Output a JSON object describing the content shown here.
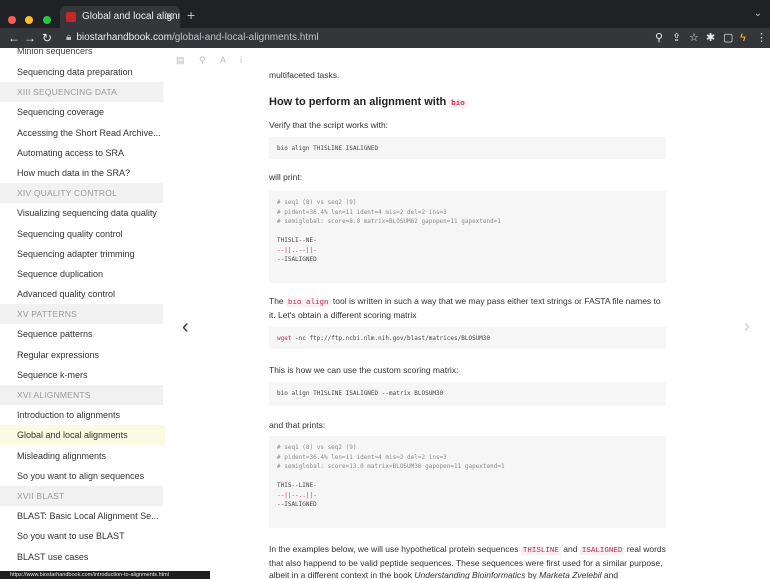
{
  "browser": {
    "tab_title": "Global and local alignments | T",
    "url_host": "biostarhandbook.com",
    "url_path": "/global-and-local-alignments.html",
    "status_url": "https://www.biostarhandbook.com/introduction-to-alignments.html",
    "colors": {
      "close": "#ff5f57",
      "minimize": "#febc2e",
      "maximize": "#28c840"
    }
  },
  "sidebar": {
    "items": [
      {
        "type": "item",
        "label": "Minion sequencers"
      },
      {
        "type": "item",
        "label": "Sequencing data preparation"
      },
      {
        "type": "header",
        "label": "XIII SEQUENCING DATA"
      },
      {
        "type": "item",
        "label": "Sequencing coverage"
      },
      {
        "type": "item",
        "label": "Accessing the Short Read Archive..."
      },
      {
        "type": "item",
        "label": "Automating access to SRA"
      },
      {
        "type": "item",
        "label": "How much data in the SRA?"
      },
      {
        "type": "header",
        "label": "XIV QUALITY CONTROL"
      },
      {
        "type": "item",
        "label": "Visualizing sequencing data quality"
      },
      {
        "type": "item",
        "label": "Sequencing quality control"
      },
      {
        "type": "item",
        "label": "Sequencing adapter trimming"
      },
      {
        "type": "item",
        "label": "Sequence duplication"
      },
      {
        "type": "item",
        "label": "Advanced quality control"
      },
      {
        "type": "header",
        "label": "XV PATTERNS"
      },
      {
        "type": "item",
        "label": "Sequence patterns"
      },
      {
        "type": "item",
        "label": "Regular expressions"
      },
      {
        "type": "item",
        "label": "Sequence k-mers"
      },
      {
        "type": "header",
        "label": "XVI ALIGNMENTS"
      },
      {
        "type": "item",
        "label": "Introduction to alignments"
      },
      {
        "type": "item",
        "label": "Global and local alignments",
        "active": true
      },
      {
        "type": "item",
        "label": "Misleading alignments"
      },
      {
        "type": "item",
        "label": "So you want to align sequences"
      },
      {
        "type": "header",
        "label": "XVII BLAST"
      },
      {
        "type": "item",
        "label": "BLAST: Basic Local Alignment Se..."
      },
      {
        "type": "item",
        "label": "So you want to use BLAST"
      },
      {
        "type": "item",
        "label": "BLAST use cases"
      }
    ]
  },
  "content": {
    "intro_tail": "multifaceted tasks.",
    "heading_text": "How to perform an alignment with",
    "heading_code": "bio",
    "verify_text": "Verify that the script works with:",
    "cmd1": "bio align THISLINE ISALIGNED",
    "will_print": "will print:",
    "output1": [
      "# seq1 (8) vs seq2 (9)",
      "# pident=36.4% len=11 ident=4 mis=2 del=2 ins=3",
      "# semiglobal: score=8.0 matrix=BLOSUM62 gapopen=11 gapextend=1",
      "",
      "THISLI--NE-",
      "--||..--||-",
      "--ISALIGNED"
    ],
    "para1_a": "The",
    "para1_code": "bio align",
    "para1_b": "tool is written in such a way that we may pass either text strings or FASTA file names to it. Let's obtain a different scoring matrix",
    "cmd2_prefix": "wget",
    "cmd2": " -nc ftp://ftp.ncbi.nlm.nih.gov/blast/matrices/BLOSUM30",
    "custom_text": "This is how we can use the custom scoring matrix:",
    "cmd3": "bio align THISLINE ISALIGNED --matrix BLOSUM30",
    "that_prints": "and that prints:",
    "output2": [
      "# seq1 (8) vs seq2 (9)",
      "# pident=36.4% len=11 ident=4 mis=2 del=2 ins=3",
      "# semiglobal: score=13.0 matrix=BLOSUM30 gapopen=11 gapextend=1",
      "",
      "THIS--LINE-",
      "--||--..||-",
      "--ISALIGNED"
    ],
    "para2_a": "In the examples below, we will use hypothetical protein sequences",
    "para2_code1": "THISLINE",
    "para2_and": "and",
    "para2_code2": "ISALIGNED",
    "para2_b": "real words that also happend to be valid peptide sequences. These sequences were first used for a similar purpose, albeit in a different context in the book",
    "para2_book": "Understanding Bioinformatics",
    "para2_c": "by",
    "para2_author": "Marketa Zvelebil",
    "para2_d": "and"
  },
  "nav": {
    "prev": "‹",
    "next": "›"
  }
}
